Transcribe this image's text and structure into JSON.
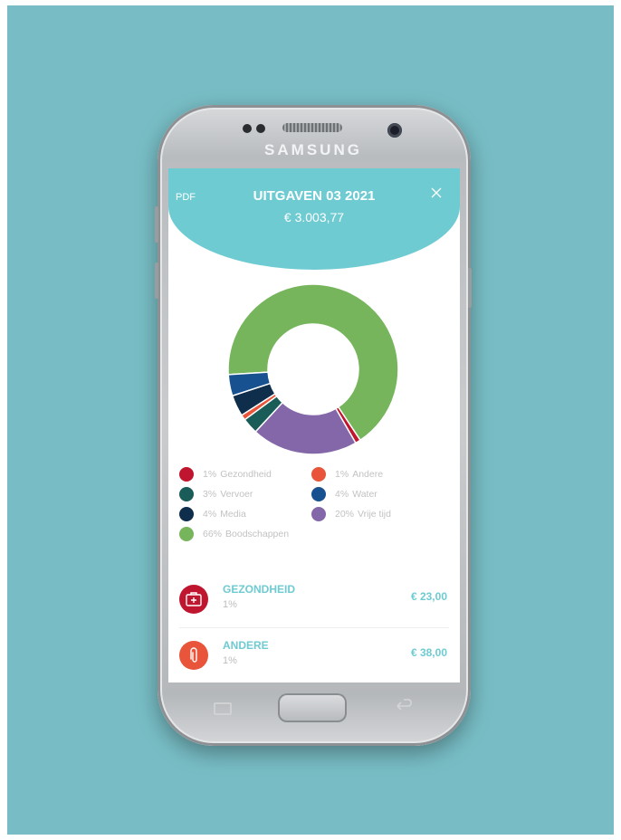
{
  "device": {
    "brand": "SAMSUNG"
  },
  "header": {
    "pdf_label": "PDF",
    "title": "UITGAVEN 03 2021",
    "total": "€ 3.003,77",
    "close_icon": "close-icon",
    "color": "#6ecbd2"
  },
  "chart_data": {
    "type": "pie",
    "donut": true,
    "title": "",
    "slices": [
      {
        "label": "Boodschappen",
        "value": 66,
        "color": "#76b55c"
      },
      {
        "label": "Gezondheid",
        "value": 1,
        "color": "#c0152e"
      },
      {
        "label": "Vrije tijd",
        "value": 20,
        "color": "#8467a8"
      },
      {
        "label": "Vervoer",
        "value": 3,
        "color": "#1a5c57"
      },
      {
        "label": "Andere",
        "value": 1,
        "color": "#e8553a"
      },
      {
        "label": "Media",
        "value": 4,
        "color": "#0f2e4b"
      },
      {
        "label": "Water",
        "value": 4,
        "color": "#17518f"
      }
    ],
    "legend": [
      {
        "pct": "1%",
        "label": "Gezondheid",
        "color": "#c0152e"
      },
      {
        "pct": "1%",
        "label": "Andere",
        "color": "#e8553a"
      },
      {
        "pct": "3%",
        "label": "Vervoer",
        "color": "#1a5c57"
      },
      {
        "pct": "4%",
        "label": "Water",
        "color": "#17518f"
      },
      {
        "pct": "4%",
        "label": "Media",
        "color": "#0f2e4b"
      },
      {
        "pct": "20%",
        "label": "Vrije tijd",
        "color": "#8467a8"
      },
      {
        "pct": "66%",
        "label": "Boodschappen",
        "color": "#76b55c"
      }
    ]
  },
  "categories": [
    {
      "name": "GEZONDHEID",
      "pct": "1%",
      "amount": "€ 23,00",
      "icon": "first-aid-kit-icon",
      "color": "#c0152e"
    },
    {
      "name": "ANDERE",
      "pct": "1%",
      "amount": "€ 38,00",
      "icon": "paperclip-icon",
      "color": "#e8553a"
    }
  ]
}
